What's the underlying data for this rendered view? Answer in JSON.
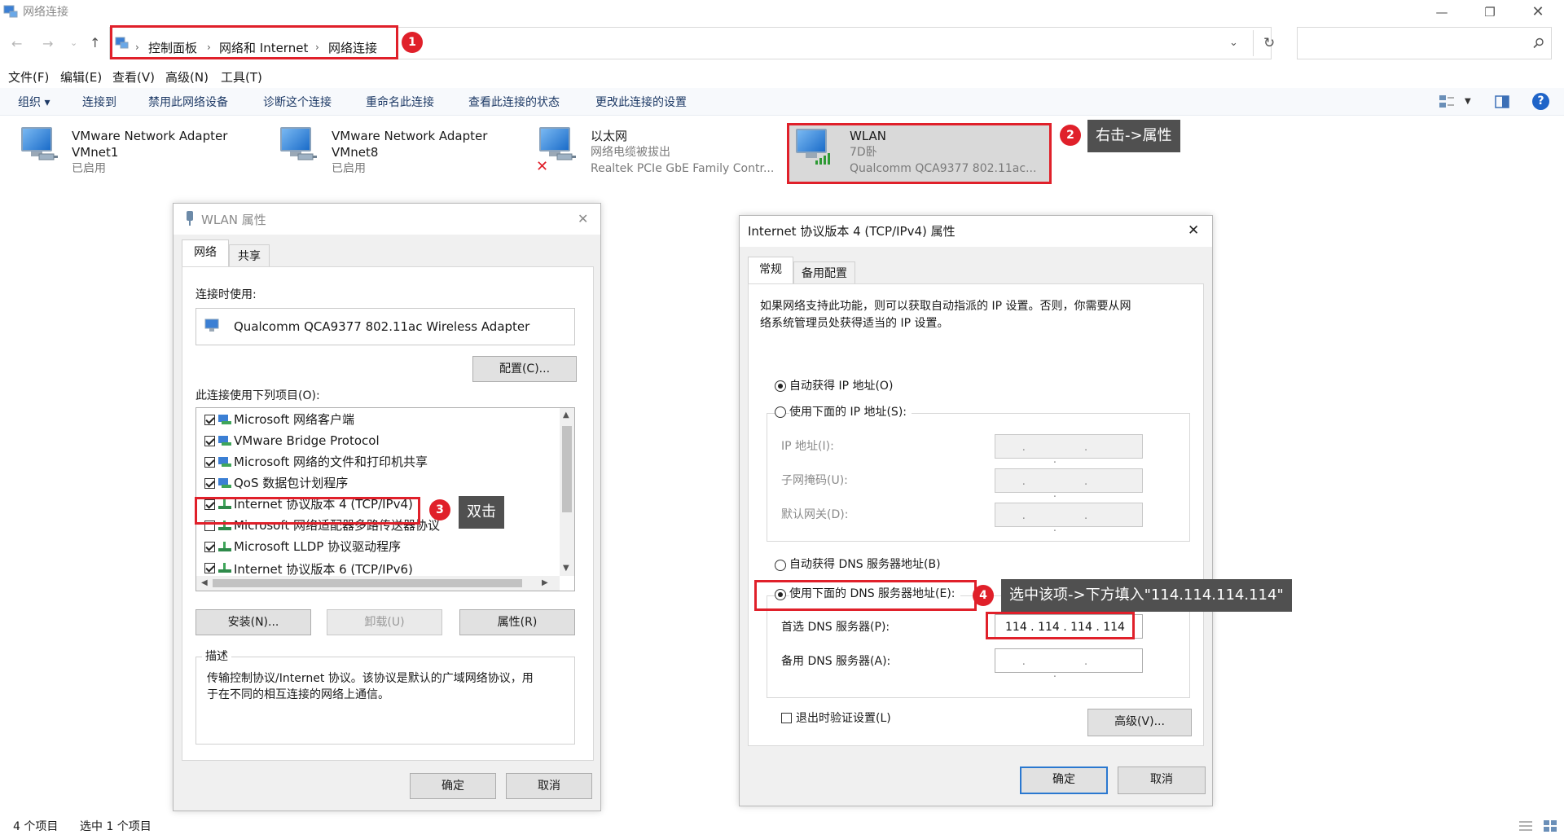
{
  "window": {
    "title": "网络连接"
  },
  "address": {
    "crumbs": [
      "控制面板",
      "网络和 Internet",
      "网络连接"
    ]
  },
  "menu": [
    "文件(F)",
    "编辑(E)",
    "查看(V)",
    "高级(N)",
    "工具(T)"
  ],
  "commands": [
    "组织 ▾",
    "连接到",
    "禁用此网络设备",
    "诊断这个连接",
    "重命名此连接",
    "查看此连接的状态",
    "更改此连接的设置"
  ],
  "adapters": [
    {
      "name": "VMware Network Adapter",
      "line2": "VMnet1",
      "line3": "已启用"
    },
    {
      "name": "VMware Network Adapter",
      "line2": "VMnet8",
      "line3": "已启用"
    },
    {
      "name": "以太网",
      "line2": "网络电缆被拔出",
      "line3": "Realtek PCIe GbE Family Contr..."
    },
    {
      "name": "WLAN",
      "line2": "7D卧",
      "line3": "Qualcomm QCA9377 802.11ac..."
    }
  ],
  "annotations": {
    "n1": "1",
    "n2": "2",
    "n3": "3",
    "n4": "4",
    "tip2": "右击->属性",
    "tip3": "双击",
    "tip4": "选中该项->下方填入\"114.114.114.114\""
  },
  "wlan_dialog": {
    "title": "WLAN 属性",
    "tabs": [
      "网络",
      "共享"
    ],
    "connect_using_label": "连接时使用:",
    "adapter": "Qualcomm QCA9377 802.11ac Wireless Adapter",
    "configure": "配置(C)...",
    "items_label": "此连接使用下列项目(O):",
    "items": [
      {
        "label": "Microsoft 网络客户端",
        "checked": true
      },
      {
        "label": "VMware Bridge Protocol",
        "checked": true
      },
      {
        "label": "Microsoft 网络的文件和打印机共享",
        "checked": true
      },
      {
        "label": "QoS 数据包计划程序",
        "checked": true
      },
      {
        "label": "Internet 协议版本 4 (TCP/IPv4)",
        "checked": true
      },
      {
        "label": "Microsoft 网络适配器多路传送器协议",
        "checked": false
      },
      {
        "label": "Microsoft LLDP 协议驱动程序",
        "checked": true
      },
      {
        "label": "Internet 协议版本 6 (TCP/IPv6)",
        "checked": true
      }
    ],
    "install": "安装(N)...",
    "uninstall": "卸载(U)",
    "properties": "属性(R)",
    "desc_label": "描述",
    "desc_text_1": "传输控制协议/Internet 协议。该协议是默认的广域网络协议，用",
    "desc_text_2": "于在不同的相互连接的网络上通信。",
    "ok": "确定",
    "cancel": "取消"
  },
  "ipv4_dialog": {
    "title": "Internet 协议版本 4 (TCP/IPv4) 属性",
    "tabs": [
      "常规",
      "备用配置"
    ],
    "intro_1": "如果网络支持此功能，则可以获取自动指派的 IP 设置。否则，你需要从网",
    "intro_2": "络系统管理员处获得适当的 IP 设置。",
    "auto_ip": "自动获得 IP 地址(O)",
    "manual_ip": "使用下面的 IP 地址(S):",
    "ip_label": "IP 地址(I):",
    "mask_label": "子网掩码(U):",
    "gateway_label": "默认网关(D):",
    "empty_ip": ". . .",
    "auto_dns": "自动获得 DNS 服务器地址(B)",
    "manual_dns": "使用下面的 DNS 服务器地址(E):",
    "pref_dns_label": "首选 DNS 服务器(P):",
    "pref_dns_value": "114 . 114 . 114 . 114",
    "alt_dns_label": "备用 DNS 服务器(A):",
    "validate": "退出时验证设置(L)",
    "advanced": "高级(V)...",
    "ok": "确定",
    "cancel": "取消"
  },
  "status": {
    "items": "4 个项目",
    "selected": "选中 1 个项目"
  }
}
